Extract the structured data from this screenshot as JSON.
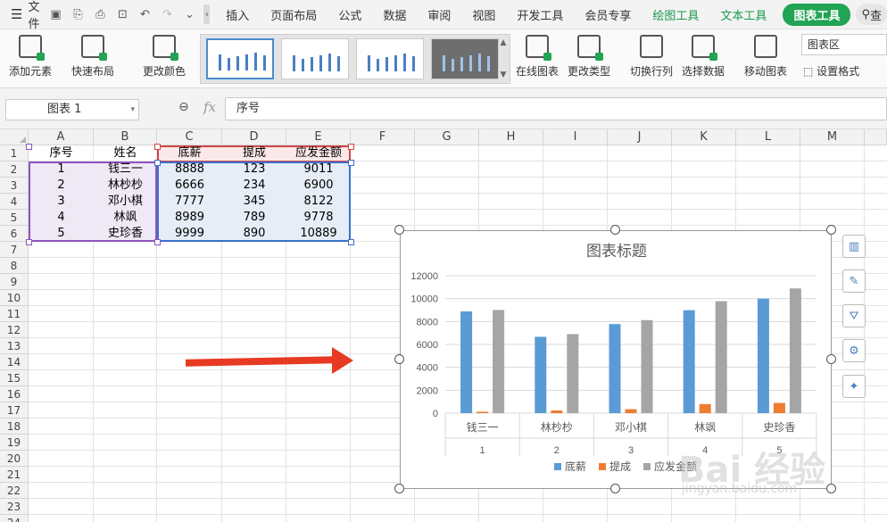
{
  "menubar": {
    "file_label": "文件",
    "tabs": [
      "插入",
      "页面布局",
      "公式",
      "数据",
      "审阅",
      "视图",
      "开发工具",
      "会员专享",
      "绘图工具",
      "文本工具",
      "图表工具"
    ],
    "search_label": "查"
  },
  "ribbon": {
    "add_element": "添加元素",
    "quick_layout": "快速布局",
    "change_color": "更改颜色",
    "online_chart": "在线图表",
    "change_type": "更改类型",
    "switch_row_col": "切换行列",
    "select_data": "选择数据",
    "move_chart": "移动图表",
    "chart_area": "图表区",
    "set_format": "设置格式"
  },
  "formula_bar": {
    "name_box": "图表 1",
    "fx": "fx",
    "value": "序号"
  },
  "sheet": {
    "columns": [
      "A",
      "B",
      "C",
      "D",
      "E",
      "F",
      "G",
      "H",
      "I",
      "J",
      "K",
      "L",
      "M"
    ],
    "rows": [
      "1",
      "2",
      "3",
      "4",
      "5",
      "6",
      "7",
      "8",
      "9",
      "10",
      "11",
      "12",
      "13",
      "14",
      "15",
      "16",
      "17",
      "18",
      "19",
      "20",
      "21",
      "22",
      "23",
      "24"
    ],
    "headers": [
      "序号",
      "姓名",
      "底薪",
      "提成",
      "应发金额"
    ],
    "data": [
      [
        "1",
        "钱三一",
        "8888",
        "123",
        "9011"
      ],
      [
        "2",
        "林杪杪",
        "6666",
        "234",
        "6900"
      ],
      [
        "3",
        "邓小棋",
        "7777",
        "345",
        "8122"
      ],
      [
        "4",
        "林飒",
        "8989",
        "789",
        "9778"
      ],
      [
        "5",
        "史珍香",
        "9999",
        "890",
        "10889"
      ]
    ]
  },
  "chart_data": {
    "type": "bar",
    "title": "图表标题",
    "categories": [
      "钱三一",
      "林杪杪",
      "邓小棋",
      "林飒",
      "史珍香"
    ],
    "sub_categories": [
      "1",
      "2",
      "3",
      "4",
      "5"
    ],
    "series": [
      {
        "name": "底薪",
        "color": "#5b9bd5",
        "values": [
          8888,
          6666,
          7777,
          8989,
          9999
        ]
      },
      {
        "name": "提成",
        "color": "#ed7d31",
        "values": [
          123,
          234,
          345,
          789,
          890
        ]
      },
      {
        "name": "应发金额",
        "color": "#a5a5a5",
        "values": [
          9011,
          6900,
          8122,
          9778,
          10889
        ]
      }
    ],
    "ylim": [
      0,
      12000
    ],
    "yticks": [
      "0",
      "2000",
      "4000",
      "6000",
      "8000",
      "10000",
      "12000"
    ],
    "grid": true,
    "legend": "bottom"
  },
  "watermark": {
    "main": "Bai 经验",
    "sub": "jingyan.baidu.com"
  }
}
